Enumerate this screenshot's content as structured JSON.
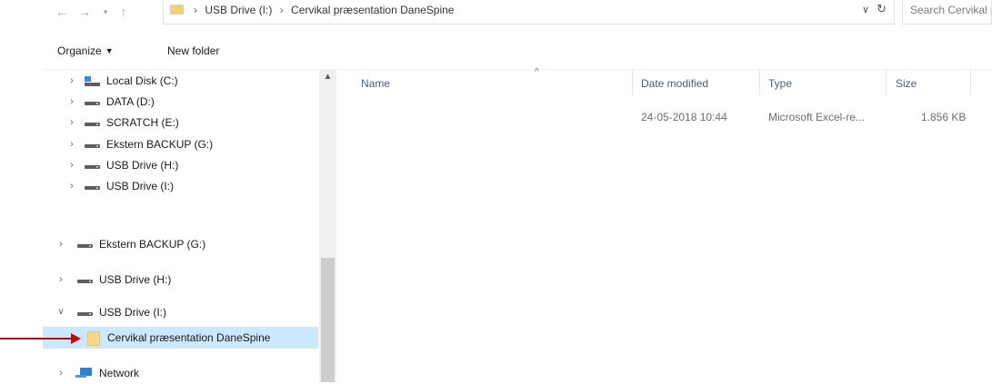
{
  "address": {
    "up_glyph": "↑",
    "path": [
      "USB Drive (I:)",
      "Cervikal præsentation DaneSpine"
    ],
    "search_placeholder": "Search Cervikal præsentation DaneSpine"
  },
  "toolbar": {
    "organize_label": "Organize",
    "new_folder_label": "New folder"
  },
  "nav_tree": {
    "items": [
      {
        "label": "Local Disk (C:)",
        "icon": "local-disk-icon",
        "expanded": false
      },
      {
        "label": "DATA (D:)",
        "icon": "drive-icon",
        "expanded": false
      },
      {
        "label": "SCRATCH (E:)",
        "icon": "drive-icon",
        "expanded": false
      },
      {
        "label": "Ekstern BACKUP (G:)",
        "icon": "drive-icon",
        "expanded": false
      },
      {
        "label": "USB Drive (H:)",
        "icon": "drive-icon",
        "expanded": false
      },
      {
        "label": "USB Drive (I:)",
        "icon": "drive-icon",
        "expanded": false
      },
      {
        "label": "Ekstern BACKUP (G:)",
        "icon": "drive-icon",
        "expanded": false
      },
      {
        "label": "USB Drive (H:)",
        "icon": "drive-icon",
        "expanded": false
      },
      {
        "label": "USB Drive (I:)",
        "icon": "drive-icon",
        "expanded": true
      },
      {
        "label": "Cervikal præsentation DaneSpine",
        "icon": "folder-icon",
        "selected": true
      },
      {
        "label": "Network",
        "icon": "network-icon",
        "expanded": false
      }
    ]
  },
  "file_list": {
    "columns": [
      "Name",
      "Date modified",
      "Type",
      "Size"
    ],
    "rows": [
      {
        "name": "",
        "date_modified": "24-05-2018 10:44",
        "type": "Microsoft Excel-re...",
        "size": "1.856 KB"
      }
    ]
  },
  "colors": {
    "selection": "#cce8ff",
    "annotation_arrow": "#b50e0e",
    "folder": "#f5d889"
  }
}
